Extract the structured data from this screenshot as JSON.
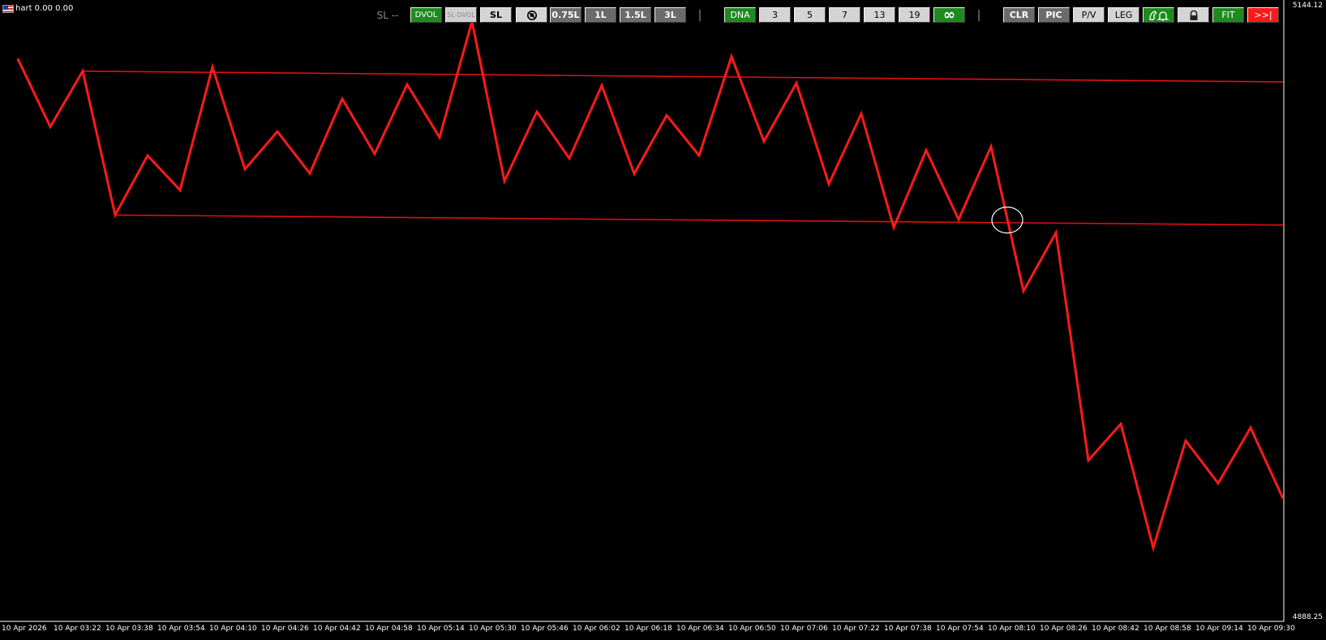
{
  "chart_title": "hart 0.00 0.00",
  "toolbar": {
    "sl_label": "SL --",
    "dvol": "DVOL",
    "sl_dvol": "SL-DVOL",
    "sl": "SL",
    "lot_075": "0.75L",
    "lot_1": "1L",
    "lot_15": "1.5L",
    "lot_3": "3L",
    "separator": "|",
    "dna": "DNA",
    "n3": "3",
    "n5": "5",
    "n7": "7",
    "n13": "13",
    "n19": "19",
    "infinity": "∞",
    "clr": "CLR",
    "pic": "PIC",
    "pv": "P/V",
    "leg": "LEG",
    "fit": "FIT",
    "next": ">>|"
  },
  "price_axis": {
    "top": "5144.12",
    "bottom": "4888.25"
  },
  "colors": {
    "background": "#000000",
    "line": "#ff1a1a",
    "channel": "#e01010",
    "marker": "#ffffff"
  },
  "chart_data": {
    "type": "line",
    "title": "",
    "xlabel": "",
    "ylabel": "",
    "ylim": [
      4888.25,
      5144.12
    ],
    "grid": false,
    "x_ticks": [
      "10 Apr 2026",
      "10 Apr 03:22",
      "10 Apr 03:38",
      "10 Apr 03:54",
      "10 Apr 04:10",
      "10 Apr 04:26",
      "10 Apr 04:42",
      "10 Apr 04:58",
      "10 Apr 05:14",
      "10 Apr 05:30",
      "10 Apr 05:46",
      "10 Apr 06:02",
      "10 Apr 06:18",
      "10 Apr 06:34",
      "10 Apr 06:50",
      "10 Apr 07:06",
      "10 Apr 07:22",
      "10 Apr 07:38",
      "10 Apr 07:54",
      "10 Apr 08:10",
      "10 Apr 08:26",
      "10 Apr 08:42",
      "10 Apr 08:58",
      "10 Apr 09:14",
      "10 Apr 09:30"
    ],
    "series": [
      {
        "values": [
          5121.5,
          5093.1,
          5116.4,
          5056.2,
          5081.1,
          5066.6,
          5118.1,
          5075.4,
          5091.1,
          5073.6,
          5104.8,
          5081.8,
          5110.8,
          5088.7,
          5137.2,
          5070.4,
          5099.4,
          5079.9,
          5110.4,
          5073.5,
          5097.9,
          5081.1,
          5122.5,
          5087.0,
          5111.4,
          5069.2,
          5098.6,
          5051.0,
          5083.3,
          5054.3,
          5084.8,
          5024.4,
          5048.8,
          4953.6,
          4968.8,
          4917.0,
          4961.8,
          4944.0,
          4967.2,
          4937.6
        ]
      }
    ],
    "channel_lines": [
      {
        "from": [
          2,
          5116.4
        ],
        "to": [
          39,
          5111.9
        ]
      },
      {
        "from": [
          3,
          5056.2
        ],
        "to": [
          39,
          5052.0
        ]
      }
    ],
    "marker_index": 30.5,
    "marker_value": 5054.1
  }
}
